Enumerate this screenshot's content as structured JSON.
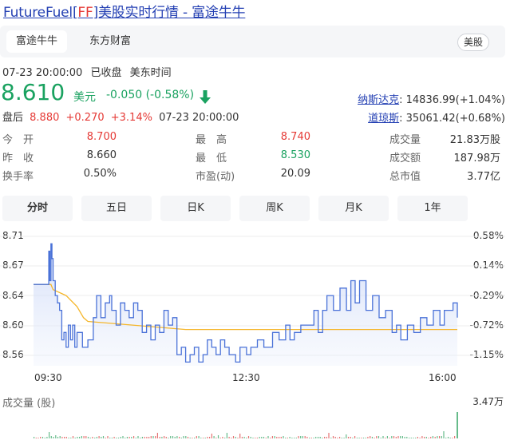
{
  "page": {
    "title_prefix": "FutureFuel[",
    "ticker": "FF",
    "title_suffix": "]美股实时行情 - 富途牛牛"
  },
  "tabs": [
    {
      "label": "富途牛牛",
      "active": true
    },
    {
      "label": "东方财富",
      "active": false
    }
  ],
  "market_badge": "美股",
  "quote_meta": {
    "datetime": "07-23 20:00:00",
    "status": "已收盘",
    "timezone": "美东时间"
  },
  "price": {
    "last": "8.610",
    "unit": "美元",
    "change": "-0.050 (-0.58%)",
    "direction": "down",
    "color": "#1aa260"
  },
  "after_hours": {
    "label": "盘后",
    "price": "8.880",
    "change": "+0.270",
    "change_pct": "+3.14%",
    "time": "07-23 20:00:00"
  },
  "indices": [
    {
      "name": "纳斯达克",
      "value": "14836.99(+1.04%)"
    },
    {
      "name": "道琼斯",
      "value": "35061.42(+0.68%)"
    }
  ],
  "stats": [
    [
      {
        "label": "今　开",
        "value": "8.700",
        "tone": "red"
      },
      {
        "label": "最　高",
        "value": "8.740",
        "tone": "red"
      },
      {
        "label": "成交量",
        "value": "21.83万股",
        "tone": "plain"
      }
    ],
    [
      {
        "label": "昨　收",
        "value": "8.660",
        "tone": "plain"
      },
      {
        "label": "最　低",
        "value": "8.530",
        "tone": "green"
      },
      {
        "label": "成交额",
        "value": "187.98万",
        "tone": "plain"
      }
    ],
    [
      {
        "label": "换手率",
        "value": "0.50%",
        "tone": "plain"
      },
      {
        "label": "市盈(动)",
        "value": "20.09",
        "tone": "plain"
      },
      {
        "label": "总市值",
        "value": "3.77亿",
        "tone": "plain"
      }
    ]
  ],
  "period_tabs": [
    {
      "label": "分时",
      "active": true
    },
    {
      "label": "五日",
      "active": false
    },
    {
      "label": "日K",
      "active": false
    },
    {
      "label": "周K",
      "active": false
    },
    {
      "label": "月K",
      "active": false
    },
    {
      "label": "1年",
      "active": false
    }
  ],
  "chart_data": {
    "type": "line",
    "price_ticks": [
      "8.71",
      "8.67",
      "8.64",
      "8.60",
      "8.56"
    ],
    "pct_ticks": [
      "0.58%",
      "0.14%",
      "-0.29%",
      "-0.72%",
      "-1.15%"
    ],
    "x_ticks": [
      "09:30",
      "12:30",
      "16:00"
    ],
    "ylim": [
      8.545,
      8.72
    ],
    "prev_close": 8.66,
    "time_range_min": [
      0,
      390
    ],
    "series": [
      {
        "role": "price",
        "color": "#4a72d8",
        "t": [
          0,
          12,
          14,
          15,
          16,
          17,
          18,
          20,
          22,
          24,
          26,
          28,
          30,
          32,
          34,
          36,
          38,
          40,
          45,
          50,
          55,
          58,
          62,
          66,
          70,
          72,
          76,
          80,
          84,
          88,
          92,
          96,
          100,
          104,
          108,
          112,
          116,
          120,
          124,
          128,
          132,
          136,
          140,
          144,
          148,
          152,
          156,
          160,
          164,
          168,
          172,
          176,
          180,
          186,
          190,
          196,
          200,
          206,
          212,
          220,
          226,
          232,
          236,
          240,
          246,
          252,
          258,
          262,
          266,
          270,
          276,
          282,
          288,
          292,
          296,
          300,
          306,
          312,
          318,
          324,
          330,
          334,
          338,
          344,
          350,
          356,
          362,
          368,
          374,
          378,
          382,
          386,
          390
        ],
        "v": [
          8.655,
          8.655,
          8.7,
          8.66,
          8.71,
          8.69,
          8.66,
          8.64,
          8.63,
          8.62,
          8.58,
          8.59,
          8.57,
          8.6,
          8.58,
          8.6,
          8.57,
          8.59,
          8.57,
          8.58,
          8.61,
          8.64,
          8.61,
          8.63,
          8.64,
          8.62,
          8.6,
          8.63,
          8.62,
          8.61,
          8.63,
          8.62,
          8.59,
          8.6,
          8.58,
          8.6,
          8.59,
          8.62,
          8.6,
          8.61,
          8.56,
          8.57,
          8.55,
          8.56,
          8.57,
          8.55,
          8.56,
          8.58,
          8.57,
          8.56,
          8.58,
          8.57,
          8.56,
          8.55,
          8.57,
          8.56,
          8.57,
          8.58,
          8.57,
          8.59,
          8.58,
          8.6,
          8.58,
          8.59,
          8.6,
          8.6,
          8.62,
          8.59,
          8.62,
          8.64,
          8.62,
          8.65,
          8.62,
          8.66,
          8.63,
          8.66,
          8.62,
          8.64,
          8.61,
          8.62,
          8.59,
          8.6,
          8.58,
          8.6,
          8.59,
          8.61,
          8.6,
          8.62,
          8.6,
          8.62,
          8.62,
          8.63,
          8.61
        ]
      },
      {
        "role": "average",
        "color": "#f5b62a",
        "t": [
          0,
          16,
          18,
          30,
          40,
          46,
          50,
          140,
          390
        ],
        "v": [
          8.655,
          8.655,
          8.648,
          8.64,
          8.625,
          8.61,
          8.605,
          8.594,
          8.594
        ]
      }
    ],
    "volume": {
      "title": "成交量 (股)",
      "max_label": "3.47万",
      "max_value": 34700,
      "last_spike": 34700,
      "bars_count": 195
    }
  }
}
